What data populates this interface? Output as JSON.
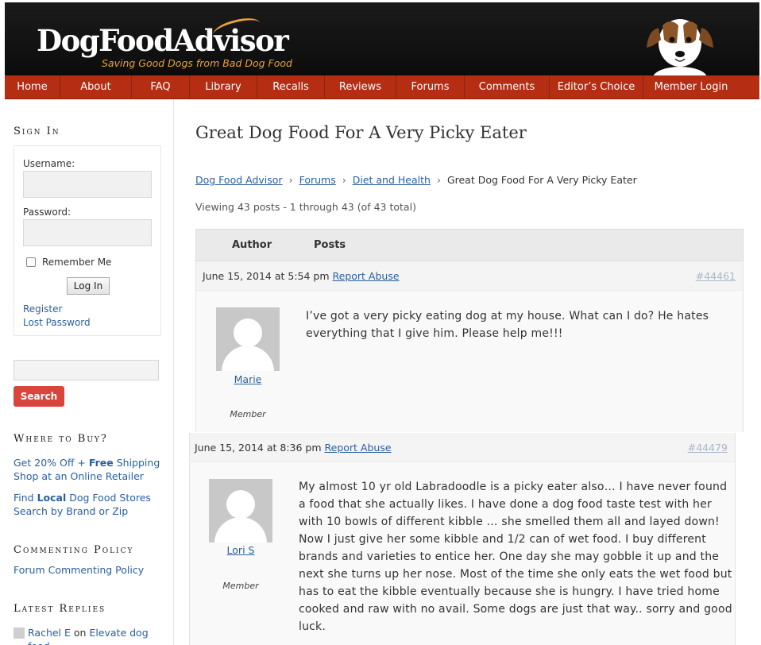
{
  "header": {
    "logo_text": "DogFoodAdvisor",
    "tagline": "Saving Good Dogs from Bad Dog Food"
  },
  "nav": {
    "items": [
      {
        "label": "Home"
      },
      {
        "label": "About"
      },
      {
        "label": "FAQ"
      },
      {
        "label": "Library"
      },
      {
        "label": "Recalls"
      },
      {
        "label": "Reviews"
      },
      {
        "label": "Forums"
      },
      {
        "label": "Comments"
      },
      {
        "label": "Editor’s Choice"
      },
      {
        "label": "Member Login"
      }
    ]
  },
  "sidebar": {
    "sign_in": {
      "heading": "Sign In",
      "username_label": "Username:",
      "username_value": "",
      "password_label": "Password:",
      "password_value": "",
      "remember_label": "Remember Me",
      "remember_checked": false,
      "login_button": "Log In",
      "register_link": "Register",
      "lost_password_link": "Lost Password"
    },
    "search": {
      "value": "",
      "button": "Search"
    },
    "where_to_buy": {
      "heading": "Where to Buy?",
      "offer_prefix": "Get 20% Off + ",
      "offer_bold": "Free",
      "offer_suffix": " Shipping",
      "offer_line2": "Shop at an Online Retailer",
      "find_prefix": "Find ",
      "find_bold": "Local",
      "find_suffix": " Dog Food Stores",
      "find_line2": "Search by Brand or Zip"
    },
    "commenting_policy": {
      "heading": "Commenting Policy",
      "link": "Forum Commenting Policy"
    },
    "latest_replies": {
      "heading": "Latest Replies",
      "items": [
        {
          "author": "Rachel E",
          "connector": " on ",
          "topic": "Elevate dog food"
        }
      ]
    }
  },
  "main": {
    "title": "Great Dog Food For A Very Picky Eater",
    "breadcrumb": [
      {
        "label": "Dog Food Advisor"
      },
      {
        "label": "Forums"
      },
      {
        "label": "Diet and Health"
      },
      {
        "label": "Great Dog Food For A Very Picky Eater"
      }
    ],
    "breadcrumb_separator": "›",
    "viewing": "Viewing 43 posts - 1 through 43 (of 43 total)",
    "table_headers": {
      "author": "Author",
      "posts": "Posts"
    },
    "posts": [
      {
        "date": "June 15, 2014 at 5:54 pm",
        "report": "Report Abuse",
        "post_id": "#44461",
        "author": "Marie",
        "role": "Member",
        "content": "I’ve got a very picky eating dog at my house. What can I do? He hates everything that I give him. Please help me!!!"
      },
      {
        "date": "June 15, 2014 at 8:36 pm",
        "report": "Report Abuse",
        "post_id": "#44479",
        "author": "Lori S",
        "role": "Member",
        "content": "My almost 10 yr old Labradoodle is a picky eater also… I have never found a food that she actually likes. I have done a dog food taste test with her with 10 bowls of different kibble … she smelled them all and layed down! Now I just give her some kibble and 1/2 can of wet food. I buy different brands and varieties to entice her. One day she may gobble it up and the next she turns up her nose. Most of the time she only eats the wet food but has to eat the kibble eventually because she is hungry. I have tried home cooked and raw with no avail. Some dogs are just that way.. sorry and good luck."
      }
    ]
  },
  "colors": {
    "nav_bg": "#b52d13",
    "header_bg": "#111111",
    "tagline": "#e8a33c",
    "link": "#2a5f9e",
    "search_button": "#d9443c"
  }
}
